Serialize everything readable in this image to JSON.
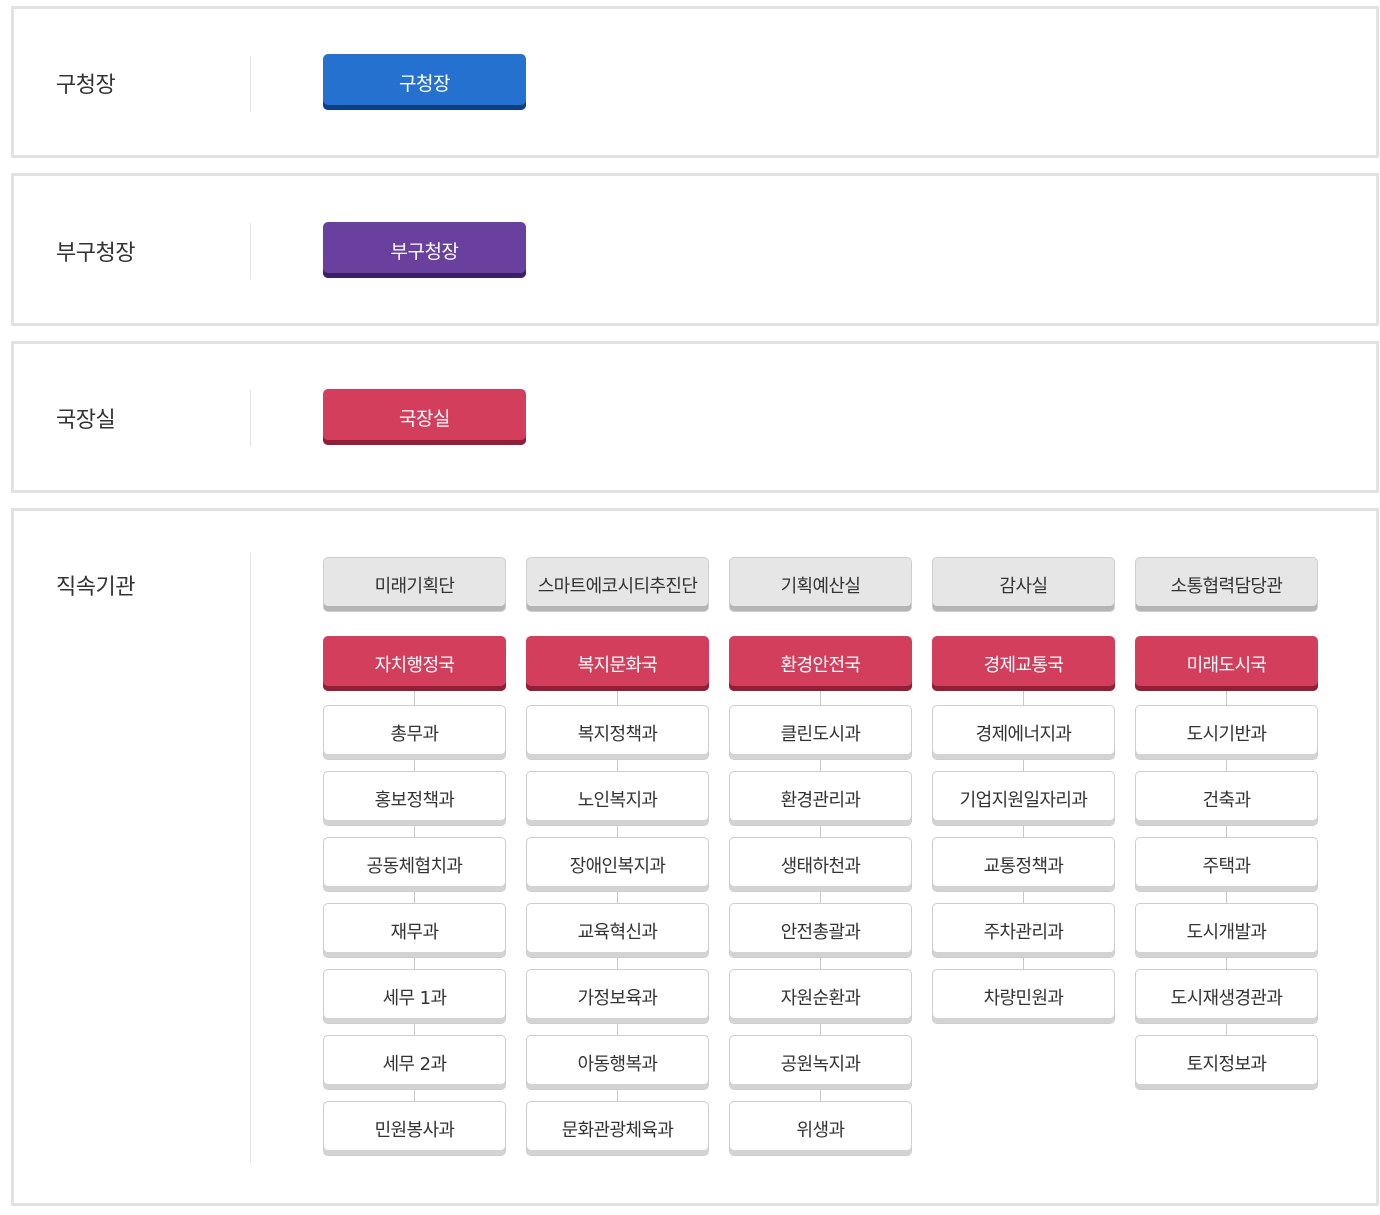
{
  "sections": {
    "mayor": {
      "label": "구청장",
      "button": "구청장",
      "color": "#2571cf"
    },
    "deputy": {
      "label": "부구청장",
      "button": "부구청장",
      "color": "#6a409e"
    },
    "director": {
      "label": "국장실",
      "button": "국장실",
      "color": "#d33e5d"
    },
    "agencies": {
      "label": "직속기관"
    }
  },
  "direct_offices": [
    "미래기획단",
    "스마트에코시티추진단",
    "기획예산실",
    "감사실",
    "소통협력담당관"
  ],
  "bureaus": [
    {
      "name": "자치행정국",
      "departments": [
        "총무과",
        "홍보정책과",
        "공동체협치과",
        "재무과",
        "세무 1과",
        "세무 2과",
        "민원봉사과"
      ]
    },
    {
      "name": "복지문화국",
      "departments": [
        "복지정책과",
        "노인복지과",
        "장애인복지과",
        "교육혁신과",
        "가정보육과",
        "아동행복과",
        "문화관광체육과"
      ]
    },
    {
      "name": "환경안전국",
      "departments": [
        "클린도시과",
        "환경관리과",
        "생태하천과",
        "안전총괄과",
        "자원순환과",
        "공원녹지과",
        "위생과"
      ]
    },
    {
      "name": "경제교통국",
      "departments": [
        "경제에너지과",
        "기업지원일자리과",
        "교통정책과",
        "주차관리과",
        "차량민원과"
      ]
    },
    {
      "name": "미래도시국",
      "departments": [
        "도시기반과",
        "건축과",
        "주택과",
        "도시개발과",
        "도시재생경관과",
        "토지정보과"
      ]
    }
  ],
  "colors": {
    "gray": "#e6e6e6",
    "bureau": "#d33e5d",
    "border": "#e2e2e2"
  }
}
